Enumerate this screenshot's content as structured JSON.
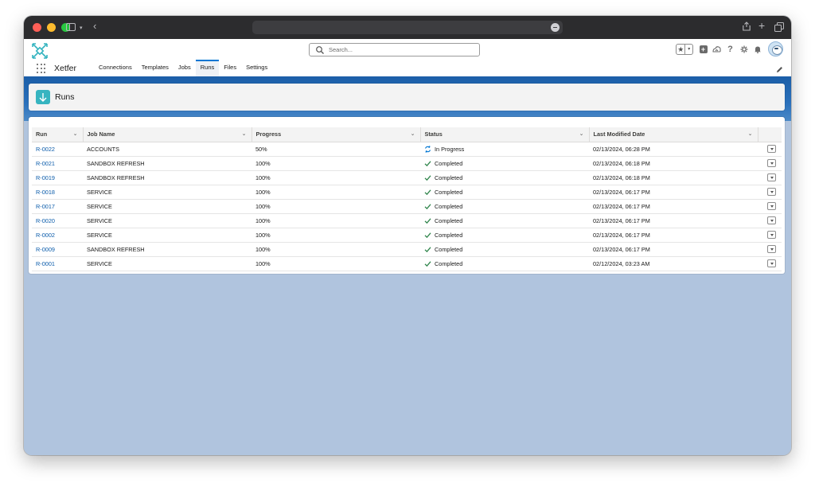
{
  "app": {
    "name": "Xetfer"
  },
  "search": {
    "placeholder": "Search..."
  },
  "nav": {
    "items": [
      "Connections",
      "Templates",
      "Jobs",
      "Runs",
      "Files",
      "Settings"
    ],
    "active": "Runs"
  },
  "page": {
    "title": "Runs"
  },
  "table": {
    "columns": [
      "Run",
      "Job Name",
      "Progress",
      "Status",
      "Last Modified Date"
    ],
    "rows": [
      {
        "run": "R-0022",
        "job": "ACCOUNTS",
        "progress": "50%",
        "status": "In Progress",
        "date": "02/13/2024, 06:28 PM"
      },
      {
        "run": "R-0021",
        "job": "SANDBOX REFRESH",
        "progress": "100%",
        "status": "Completed",
        "date": "02/13/2024, 06:18 PM"
      },
      {
        "run": "R-0019",
        "job": "SANDBOX REFRESH",
        "progress": "100%",
        "status": "Completed",
        "date": "02/13/2024, 06:18 PM"
      },
      {
        "run": "R-0018",
        "job": "SERVICE",
        "progress": "100%",
        "status": "Completed",
        "date": "02/13/2024, 06:17 PM"
      },
      {
        "run": "R-0017",
        "job": "SERVICE",
        "progress": "100%",
        "status": "Completed",
        "date": "02/13/2024, 06:17 PM"
      },
      {
        "run": "R-0020",
        "job": "SERVICE",
        "progress": "100%",
        "status": "Completed",
        "date": "02/13/2024, 06:17 PM"
      },
      {
        "run": "R-0002",
        "job": "SERVICE",
        "progress": "100%",
        "status": "Completed",
        "date": "02/13/2024, 06:17 PM"
      },
      {
        "run": "R-0009",
        "job": "SANDBOX REFRESH",
        "progress": "100%",
        "status": "Completed",
        "date": "02/13/2024, 06:17 PM"
      },
      {
        "run": "R-0001",
        "job": "SERVICE",
        "progress": "100%",
        "status": "Completed",
        "date": "02/12/2024, 03:23 AM"
      }
    ]
  },
  "icons": {
    "logo": "x-logo-icon",
    "runs": "runs-icon",
    "completed": "check-icon",
    "in_progress": "sync-icon",
    "row_action": "chevron-down-icon"
  },
  "colors": {
    "accent": "#0176d3",
    "link": "#0b5cab",
    "completed": "#2e844a",
    "in_progress": "#0176d3",
    "runs_icon_bg": "#36b4c0",
    "content_bg": "#b0c4de"
  }
}
